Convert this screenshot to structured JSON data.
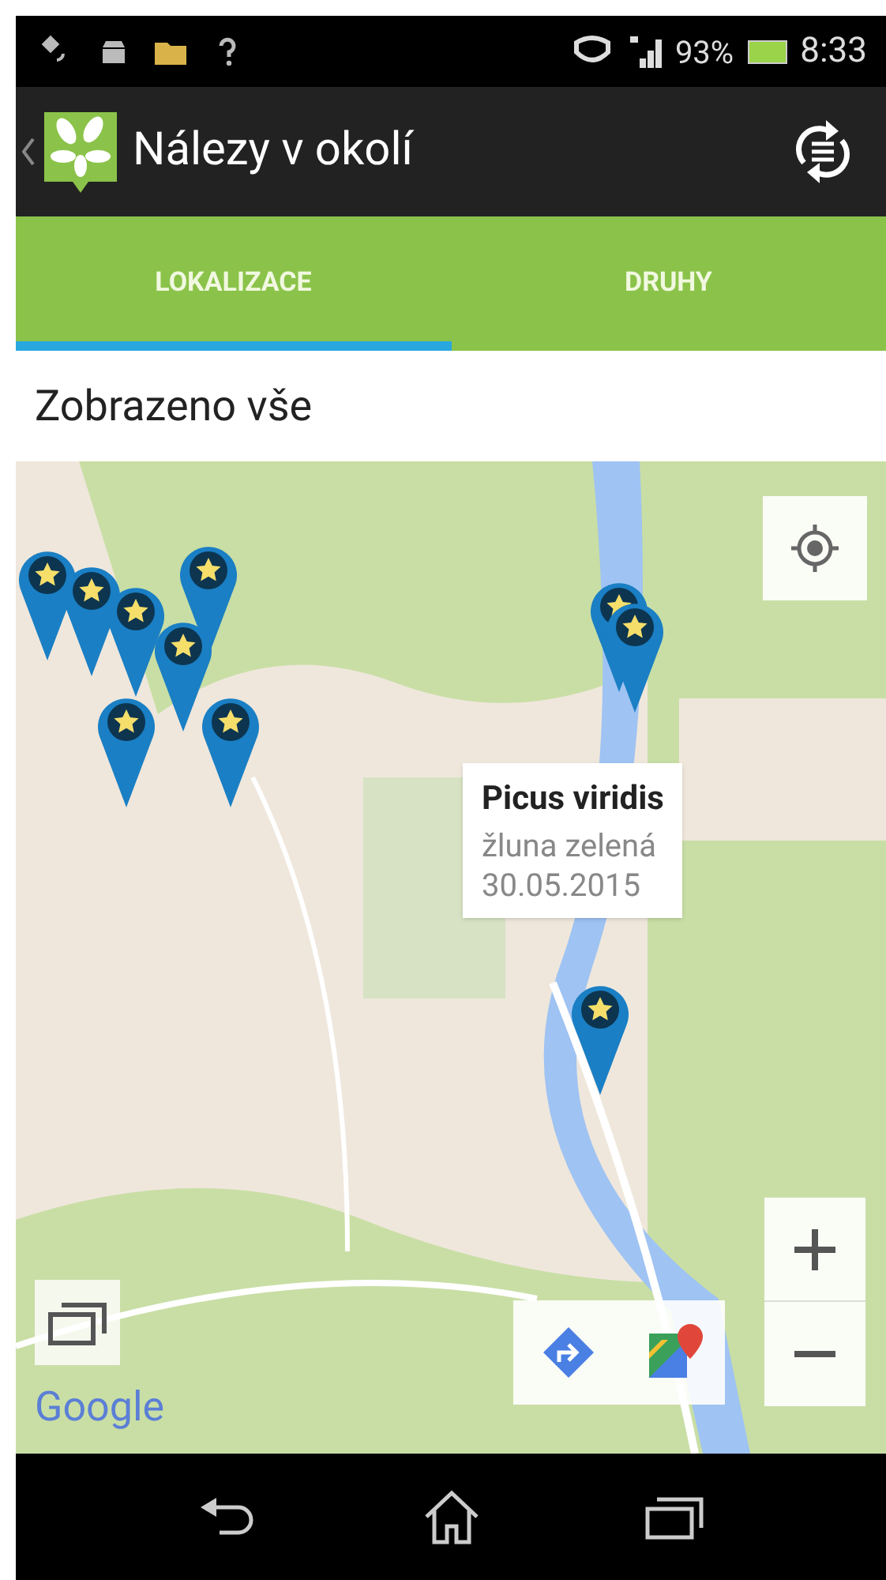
{
  "status_bar": {
    "battery": "93%",
    "time": "8:33"
  },
  "app_bar": {
    "title": "Nálezy v okolí"
  },
  "tabs": [
    {
      "label": "LOKALIZACE",
      "selected": true
    },
    {
      "label": "DRUHY",
      "selected": false
    }
  ],
  "filter_label": "Zobrazeno vše",
  "map": {
    "info_window": {
      "title": "Picus viridis",
      "subtitle": "žluna zelená",
      "date": "30.05.2015"
    },
    "attribution": "Google"
  }
}
